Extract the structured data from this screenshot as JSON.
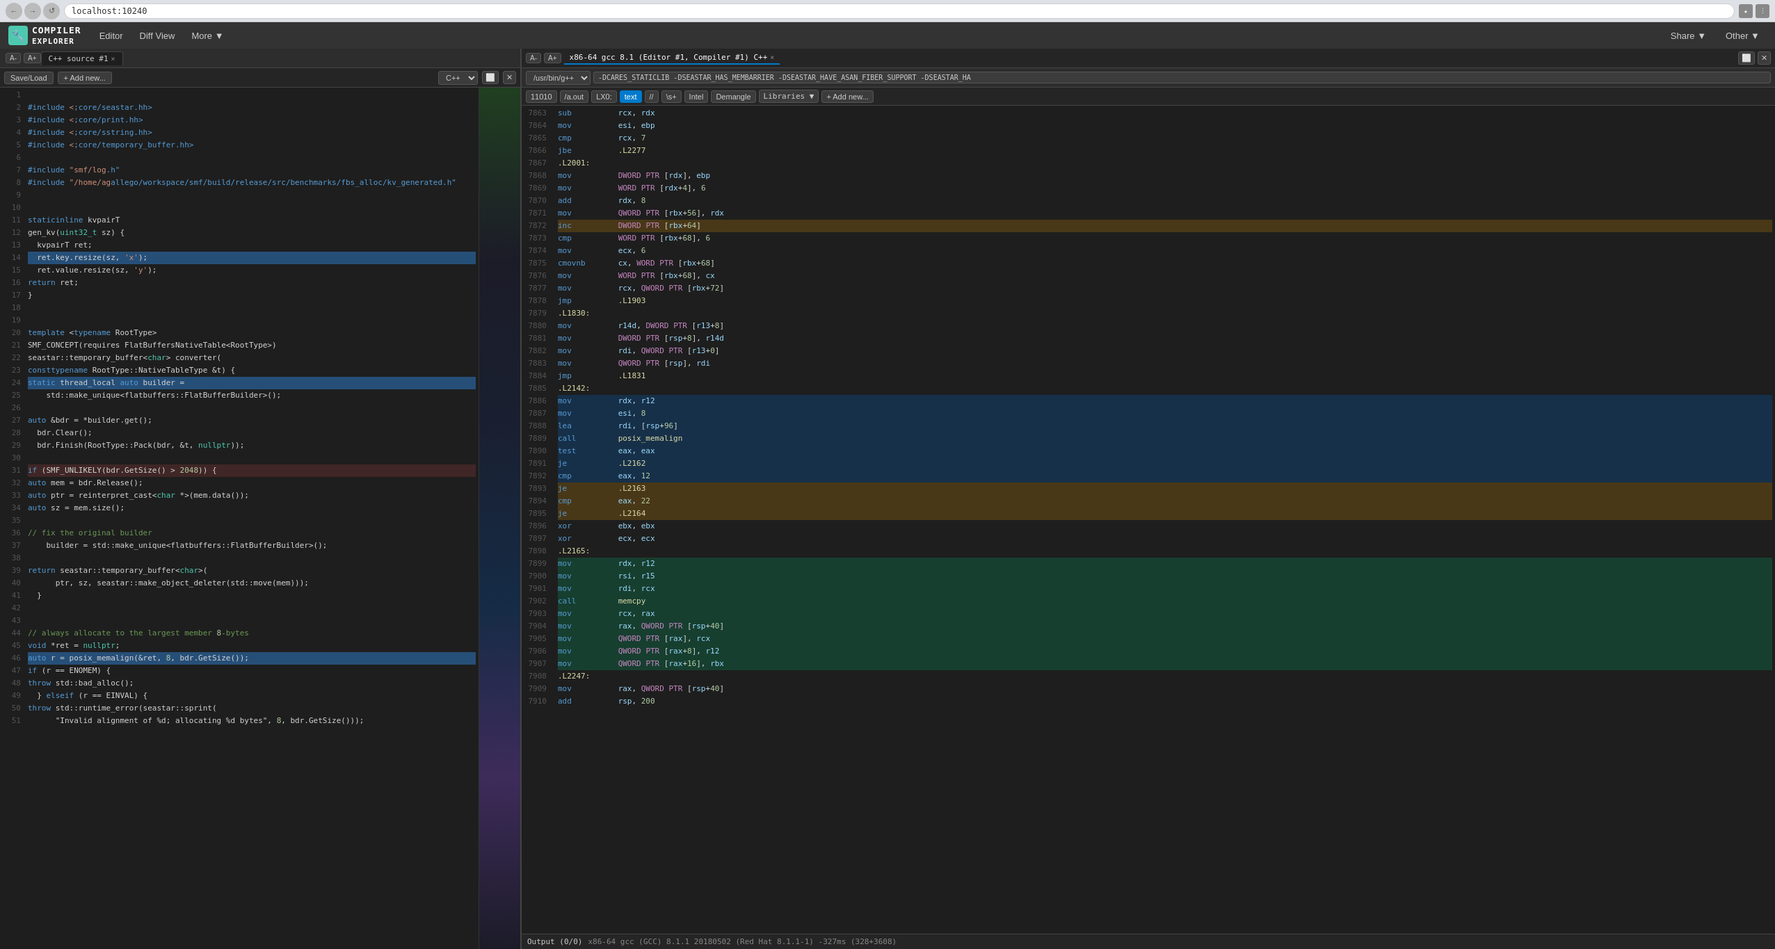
{
  "browser": {
    "url": "localhost:10240",
    "nav_buttons": [
      "←",
      "→",
      "↺"
    ]
  },
  "app": {
    "logo_icon": "🔧",
    "logo_text": "COMPILER EXPLORER",
    "nav_items": [
      "Editor",
      "Diff View",
      "More ▼"
    ],
    "header_items": [
      "Share ▼",
      "Other ▼"
    ]
  },
  "editor_tab": {
    "label": "C++ source #1",
    "close": "×"
  },
  "compiler_tab": {
    "label": "x86-64 gcc 8.1 (Editor #1, Compiler #1) C++",
    "close": "×"
  },
  "toolbar": {
    "font_size_down": "A-",
    "font_size_up": "A+",
    "save_load": "Save/Load",
    "add_new": "+ Add new..."
  },
  "editor": {
    "language": "C++",
    "lines": [
      {
        "num": 1,
        "code": ""
      },
      {
        "num": 2,
        "code": "#include <core/seastar.hh>"
      },
      {
        "num": 3,
        "code": "#include <core/print.hh>"
      },
      {
        "num": 4,
        "code": "#include <core/sstring.hh>"
      },
      {
        "num": 5,
        "code": "#include <core/temporary_buffer.hh>"
      },
      {
        "num": 6,
        "code": ""
      },
      {
        "num": 7,
        "code": "#include \"smf/log.h\""
      },
      {
        "num": 8,
        "code": "#include \"/home/agallego/workspace/smf/build/release/src/benchmarks/fbs_alloc/kv_generated.h\""
      },
      {
        "num": 9,
        "code": ""
      },
      {
        "num": 10,
        "code": ""
      },
      {
        "num": 11,
        "code": "static inline kvpairT"
      },
      {
        "num": 12,
        "code": "gen_kv(uint32_t sz) {"
      },
      {
        "num": 13,
        "code": "  kvpairT ret;"
      },
      {
        "num": 14,
        "code": "  ret.key.resize(sz, 'x');",
        "highlight": true
      },
      {
        "num": 15,
        "code": "  ret.value.resize(sz, 'y');"
      },
      {
        "num": 16,
        "code": "  return ret;"
      },
      {
        "num": 17,
        "code": "}"
      },
      {
        "num": 18,
        "code": ""
      },
      {
        "num": 19,
        "code": ""
      },
      {
        "num": 20,
        "code": "template <typename RootType>"
      },
      {
        "num": 21,
        "code": "SMF_CONCEPT(requires FlatBuffersNativeTable<RootType>)"
      },
      {
        "num": 22,
        "code": "seastar::temporary_buffer<char> converter("
      },
      {
        "num": 23,
        "code": "  const typename RootType::NativeTableType &t) {"
      },
      {
        "num": 24,
        "code": "  static thread_local auto builder =",
        "highlight": true
      },
      {
        "num": 25,
        "code": "    std::make_unique<flatbuffers::FlatBufferBuilder>();"
      },
      {
        "num": 26,
        "code": ""
      },
      {
        "num": 27,
        "code": "  auto &bdr = *builder.get();"
      },
      {
        "num": 28,
        "code": "  bdr.Clear();"
      },
      {
        "num": 29,
        "code": "  bdr.Finish(RootType::Pack(bdr, &t, nullptr));"
      },
      {
        "num": 30,
        "code": ""
      },
      {
        "num": 31,
        "code": "  if (SMF_UNLIKELY(bdr.GetSize() > 2048)) {",
        "error": true
      },
      {
        "num": 32,
        "code": "    auto mem = bdr.Release();"
      },
      {
        "num": 33,
        "code": "    auto ptr = reinterpret_cast<char *>(mem.data());"
      },
      {
        "num": 34,
        "code": "    auto sz = mem.size();"
      },
      {
        "num": 35,
        "code": ""
      },
      {
        "num": 36,
        "code": "    // fix the original builder"
      },
      {
        "num": 37,
        "code": "    builder = std::make_unique<flatbuffers::FlatBufferBuilder>();"
      },
      {
        "num": 38,
        "code": ""
      },
      {
        "num": 39,
        "code": "    return seastar::temporary_buffer<char>("
      },
      {
        "num": 40,
        "code": "      ptr, sz, seastar::make_object_deleter(std::move(mem)));"
      },
      {
        "num": 41,
        "code": "  }"
      },
      {
        "num": 42,
        "code": ""
      },
      {
        "num": 43,
        "code": ""
      },
      {
        "num": 44,
        "code": "  // always allocate to the largest member 8-bytes"
      },
      {
        "num": 45,
        "code": "  void *ret = nullptr;"
      },
      {
        "num": 46,
        "code": "  auto r = posix_memalign(&ret, 8, bdr.GetSize());",
        "highlight": true
      },
      {
        "num": 47,
        "code": "  if (r == ENOMEM) {"
      },
      {
        "num": 48,
        "code": "    throw std::bad_alloc();"
      },
      {
        "num": 49,
        "code": "  } else if (r == EINVAL) {"
      },
      {
        "num": 50,
        "code": "    throw std::runtime_error(seastar::sprint("
      },
      {
        "num": 51,
        "code": "      \"Invalid alignment of %d; allocating %d bytes\", 8, bdr.GetSize()));"
      }
    ]
  },
  "compiler": {
    "compiler_select": "/usr/bin/g++",
    "flags": "-DCARES_STATICLIB -DSEASTAR_HAS_MEMBARRIER -DSEASTAR_HAVE_ASAN_FIBER_SUPPORT -DSEASTAR_HA"
  },
  "asm_toolbar": {
    "items": [
      "LX0:",
      "text",
      "//",
      "\\s+",
      "Intel",
      "Demangle"
    ],
    "libraries": "Libraries ▼",
    "add_new": "+ Add new...",
    "line_number": "11010",
    "go_to": "/a.out"
  },
  "assembly": {
    "lines": [
      {
        "num": "7863",
        "indent": "  ",
        "instr": "sub",
        "ops": "rcx, rdx",
        "hl": ""
      },
      {
        "num": "7864",
        "indent": "  ",
        "instr": "mov",
        "ops": "esi, ebp",
        "hl": ""
      },
      {
        "num": "7865",
        "indent": "  ",
        "instr": "cmp",
        "ops": "rcx, 7",
        "hl": ""
      },
      {
        "num": "7866",
        "indent": "  ",
        "instr": "jbe",
        "ops": ".L2277",
        "hl": ""
      },
      {
        "num": "7867",
        "label": ".L2001:",
        "hl": ""
      },
      {
        "num": "7868",
        "indent": "    ",
        "instr": "mov",
        "ops": "DWORD PTR [rdx], ebp",
        "hl": ""
      },
      {
        "num": "7869",
        "indent": "    ",
        "instr": "mov",
        "ops": "WORD PTR [rdx+4], 6",
        "hl": ""
      },
      {
        "num": "7870",
        "indent": "    ",
        "instr": "add",
        "ops": "rdx, 8",
        "hl": ""
      },
      {
        "num": "7871",
        "indent": "    ",
        "instr": "mov",
        "ops": "QWORD PTR [rbx+56], rdx",
        "hl": ""
      },
      {
        "num": "7872",
        "indent": "    ",
        "instr": "inc",
        "ops": "DWORD PTR [rbx+64]",
        "hl": "orange"
      },
      {
        "num": "7873",
        "indent": "    ",
        "instr": "cmp",
        "ops": "WORD PTR [rbx+68], 6",
        "hl": ""
      },
      {
        "num": "7874",
        "indent": "    ",
        "instr": "mov",
        "ops": "ecx, 6",
        "hl": ""
      },
      {
        "num": "7875",
        "indent": "    ",
        "instr": "cmovnb",
        "ops": "cx, WORD PTR [rbx+68]",
        "hl": ""
      },
      {
        "num": "7876",
        "indent": "    ",
        "instr": "mov",
        "ops": "WORD PTR [rbx+68], cx",
        "hl": ""
      },
      {
        "num": "7877",
        "indent": "    ",
        "instr": "mov",
        "ops": "rcx, QWORD PTR [rbx+72]",
        "hl": ""
      },
      {
        "num": "7878",
        "indent": "    ",
        "instr": "jmp",
        "ops": ".L1903",
        "hl": ""
      },
      {
        "num": "7879",
        "label": ".L1830:",
        "hl": ""
      },
      {
        "num": "7880",
        "indent": "    ",
        "instr": "mov",
        "ops": "r14d, DWORD PTR [r13+8]",
        "hl": ""
      },
      {
        "num": "7881",
        "indent": "    ",
        "instr": "mov",
        "ops": "DWORD PTR [rsp+8], r14d",
        "hl": ""
      },
      {
        "num": "7882",
        "indent": "    ",
        "instr": "mov",
        "ops": "rdi, QWORD PTR [r13+0]",
        "hl": ""
      },
      {
        "num": "7883",
        "indent": "    ",
        "instr": "mov",
        "ops": "QWORD PTR [rsp], rdi",
        "hl": ""
      },
      {
        "num": "7884",
        "indent": "    ",
        "instr": "jmp",
        "ops": ".L1831",
        "hl": ""
      },
      {
        "num": "7885",
        "label": ".L2142:",
        "hl": ""
      },
      {
        "num": "7886",
        "indent": "    ",
        "instr": "mov",
        "ops": "rdx, r12",
        "hl": "blue"
      },
      {
        "num": "7887",
        "indent": "    ",
        "instr": "mov",
        "ops": "esi, 8",
        "hl": "blue"
      },
      {
        "num": "7888",
        "indent": "    ",
        "instr": "lea",
        "ops": "rdi, [rsp+96]",
        "hl": "blue"
      },
      {
        "num": "7889",
        "indent": "    ",
        "instr": "call",
        "ops": "posix_memalign",
        "hl": "blue"
      },
      {
        "num": "7890",
        "indent": "    ",
        "instr": "test",
        "ops": "eax, eax",
        "hl": "blue"
      },
      {
        "num": "7891",
        "indent": "    ",
        "instr": "je",
        "ops": ".L2162",
        "hl": "blue"
      },
      {
        "num": "7892",
        "indent": "    ",
        "instr": "cmp",
        "ops": "eax, 12",
        "hl": "blue"
      },
      {
        "num": "7893",
        "indent": "    ",
        "instr": "je",
        "ops": ".L2163",
        "hl": "orange"
      },
      {
        "num": "7894",
        "indent": "    ",
        "instr": "cmp",
        "ops": "eax, 22",
        "hl": "orange"
      },
      {
        "num": "7895",
        "indent": "    ",
        "instr": "je",
        "ops": ".L2164",
        "hl": "orange"
      },
      {
        "num": "7896",
        "indent": "    ",
        "instr": "xor",
        "ops": "ebx, ebx",
        "hl": ""
      },
      {
        "num": "7897",
        "indent": "    ",
        "instr": "xor",
        "ops": "ecx, ecx",
        "hl": ""
      },
      {
        "num": "7898",
        "label": ".L2165:",
        "hl": ""
      },
      {
        "num": "7899",
        "indent": "    ",
        "instr": "mov",
        "ops": "rdx, r12",
        "hl": "green"
      },
      {
        "num": "7900",
        "indent": "    ",
        "instr": "mov",
        "ops": "rsi, r15",
        "hl": "green"
      },
      {
        "num": "7901",
        "indent": "    ",
        "instr": "mov",
        "ops": "rdi, rcx",
        "hl": "green"
      },
      {
        "num": "7902",
        "indent": "    ",
        "instr": "call",
        "ops": "memcpy",
        "hl": "green"
      },
      {
        "num": "7903",
        "indent": "    ",
        "instr": "mov",
        "ops": "rcx, rax",
        "hl": "green"
      },
      {
        "num": "7904",
        "indent": "    ",
        "instr": "mov",
        "ops": "rax, QWORD PTR [rsp+40]",
        "hl": "green"
      },
      {
        "num": "7905",
        "indent": "    ",
        "instr": "mov",
        "ops": "QWORD PTR [rax], rcx",
        "hl": "green"
      },
      {
        "num": "7906",
        "indent": "    ",
        "instr": "mov",
        "ops": "QWORD PTR [rax+8], r12",
        "hl": "green"
      },
      {
        "num": "7907",
        "indent": "    ",
        "instr": "mov",
        "ops": "QWORD PTR [rax+16], rbx",
        "hl": "green"
      },
      {
        "num": "7908",
        "label": ".L2247:",
        "hl": ""
      },
      {
        "num": "7909",
        "indent": "    ",
        "instr": "mov",
        "ops": "rax, QWORD PTR [rsp+40]",
        "hl": ""
      },
      {
        "num": "7910",
        "indent": "    ",
        "instr": "add",
        "ops": "rsp, 200",
        "hl": ""
      }
    ]
  },
  "output": {
    "text": "x86-64 gcc (GCC) 8.1.1 20180502 (Red Hat 8.1.1-1)  -327ms (328+3608)"
  }
}
